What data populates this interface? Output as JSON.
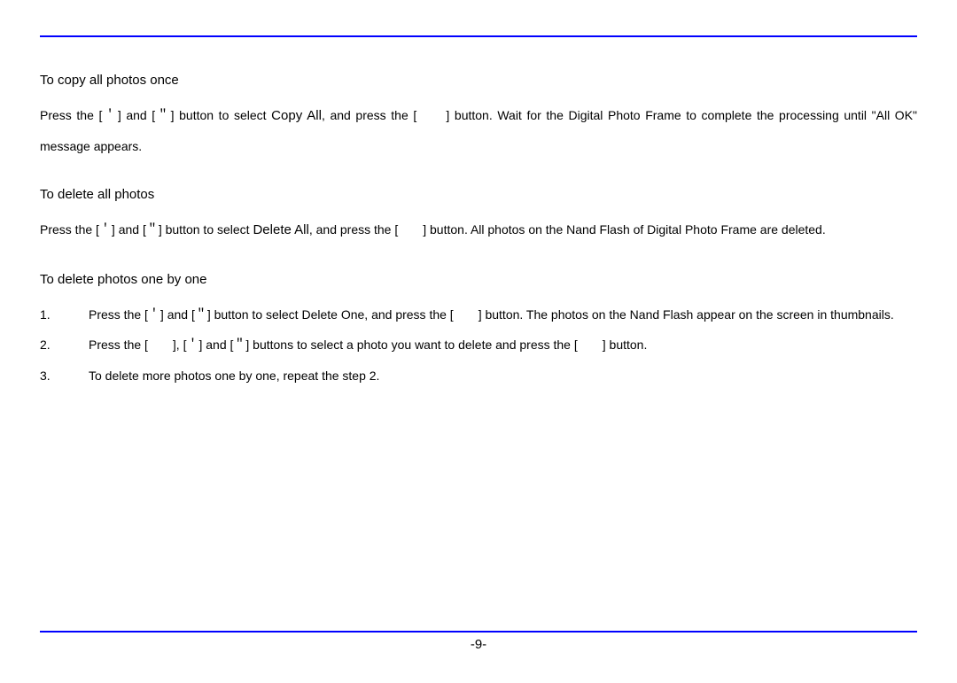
{
  "sections": [
    {
      "title": "To copy all photos once",
      "text_parts": {
        "pre": "Press the [＇] and [＂] button to select ",
        "strong": "Copy All",
        "post": ", and press the [　　] button. Wait for the Digital Photo Frame to complete the processing until \"All OK\" message appears."
      }
    },
    {
      "title": "To delete all photos",
      "text_parts": {
        "pre": "Press the [＇] and [＂] button to select ",
        "strong": "Delete All",
        "post": ", and press the [　　] button. All photos on the Nand Flash of Digital Photo Frame are deleted."
      }
    },
    {
      "title": "To delete photos one by one",
      "list": [
        {
          "num": "1.",
          "pre": "Press the [＇] and [＂] button to select ",
          "strong": "Delete One",
          "post": ", and press the [　　] button. The photos on the Nand Flash appear on the screen in thumbnails."
        },
        {
          "num": "2.",
          "pre": "Press the [　　], [＇] and [＂] buttons to select a photo you want to delete and press the [　　] button.",
          "strong": "",
          "post": ""
        },
        {
          "num": "3.",
          "pre": "To delete more photos one by one, repeat the step 2.",
          "strong": "",
          "post": ""
        }
      ]
    }
  ],
  "page_number": "-9-"
}
